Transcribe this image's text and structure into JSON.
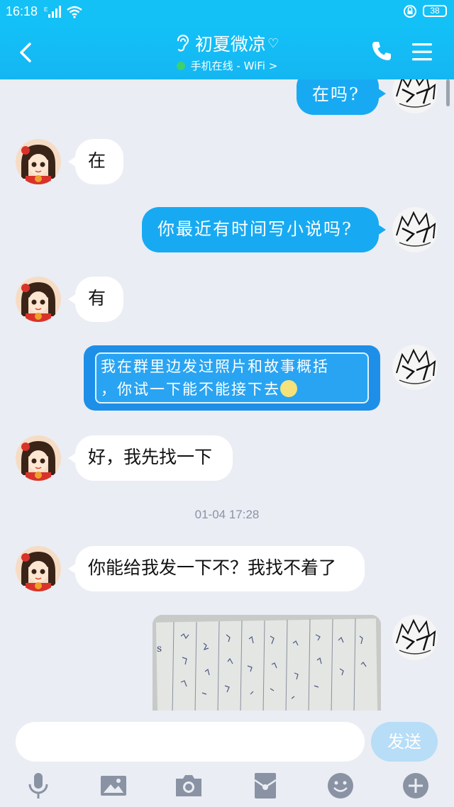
{
  "status": {
    "time": "16:18",
    "network": "E",
    "battery": "38"
  },
  "header": {
    "contact_name": "初夏微凉",
    "heart": "♡",
    "online_status": "手机在线 - WiFi >"
  },
  "messages": {
    "m1": "在吗?",
    "m2": "在",
    "m3": "你最近有时间写小说吗?",
    "m4": "有",
    "m5_line1": "我在群里边发过照片和故事概括",
    "m5_line2": "，你试一下能不能接下去",
    "m6": "好，我先找一下",
    "timestamp": "01-04 17:28",
    "m7": "你能给我发一下不？我找不着了"
  },
  "input": {
    "placeholder": "",
    "send_label": "发送"
  },
  "colors": {
    "accent": "#13c1f7",
    "bubble_right": "#17aaf2",
    "bg": "#eaedf4"
  }
}
